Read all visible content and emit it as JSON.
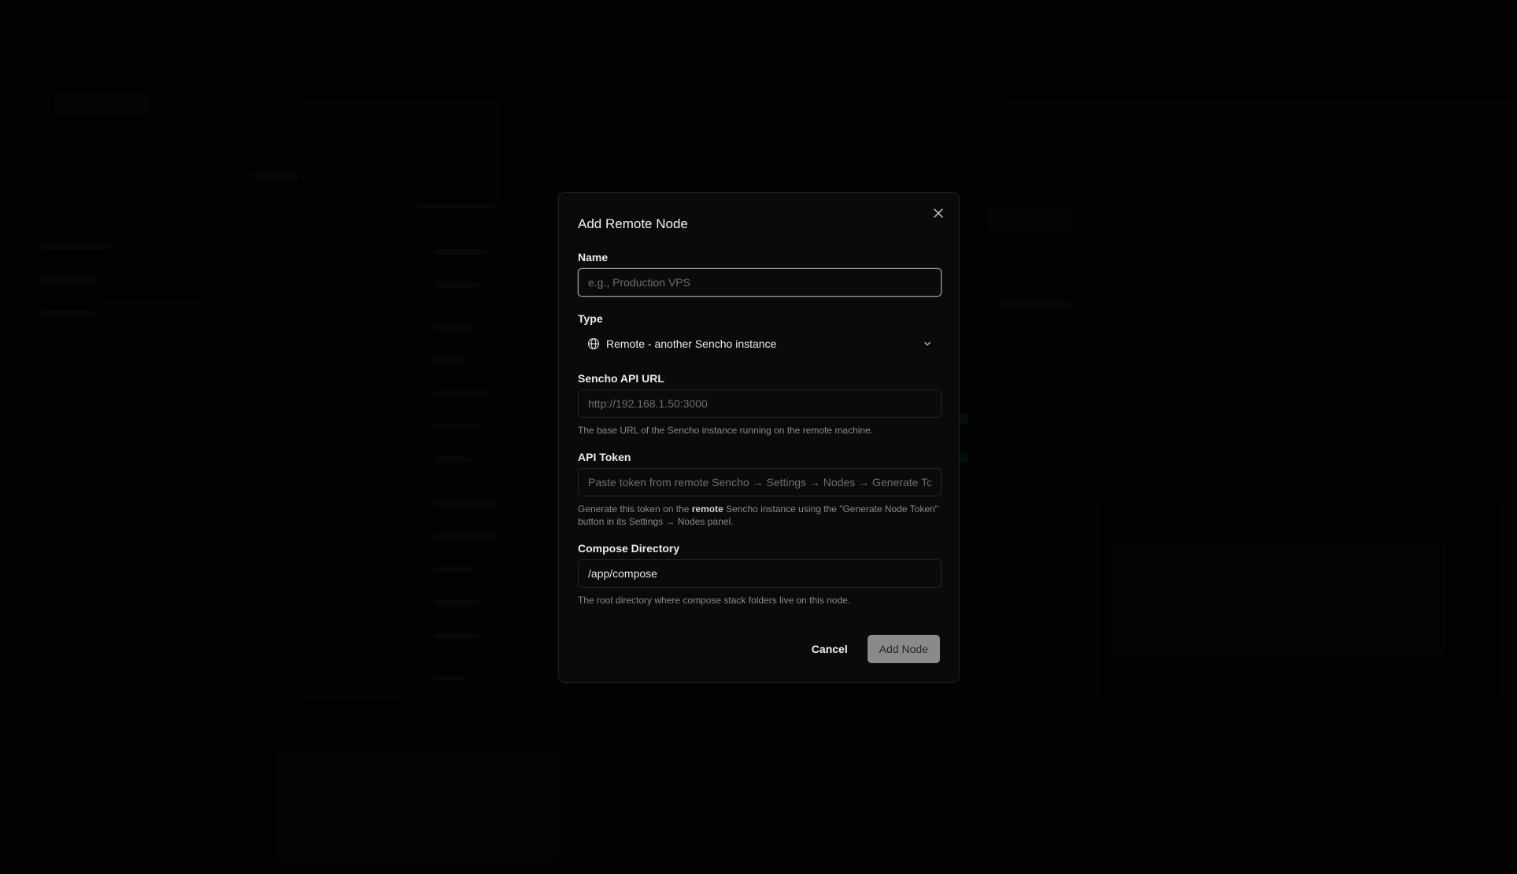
{
  "dialog": {
    "title": "Add Remote Node",
    "fields": {
      "name": {
        "label": "Name",
        "value": "",
        "placeholder": "e.g., Production VPS"
      },
      "type": {
        "label": "Type",
        "selected": "Remote - another Sencho instance",
        "icon": "globe-icon"
      },
      "api_url": {
        "label": "Sencho API URL",
        "value": "",
        "placeholder": "http://192.168.1.50:3000",
        "hint": "The base URL of the Sencho instance running on the remote machine."
      },
      "api_token": {
        "label": "API Token",
        "value": "",
        "placeholder": "Paste token from remote Sencho → Settings → Nodes → Generate Token",
        "hint_before": "Generate this token on the ",
        "hint_bold": "remote",
        "hint_after": " Sencho instance using the \"Generate Node Token\" button in its Settings → Nodes panel."
      },
      "compose_dir": {
        "label": "Compose Directory",
        "value": "/app/compose",
        "placeholder": "",
        "hint": "The root directory where compose stack folders live on this node."
      }
    },
    "buttons": {
      "cancel": "Cancel",
      "submit": "Add Node"
    }
  },
  "colors": {
    "background": "#0a0a0a",
    "border": "#262626",
    "focus_ring": "#9aa8a6",
    "primary_disabled": "#8a8a8a"
  }
}
